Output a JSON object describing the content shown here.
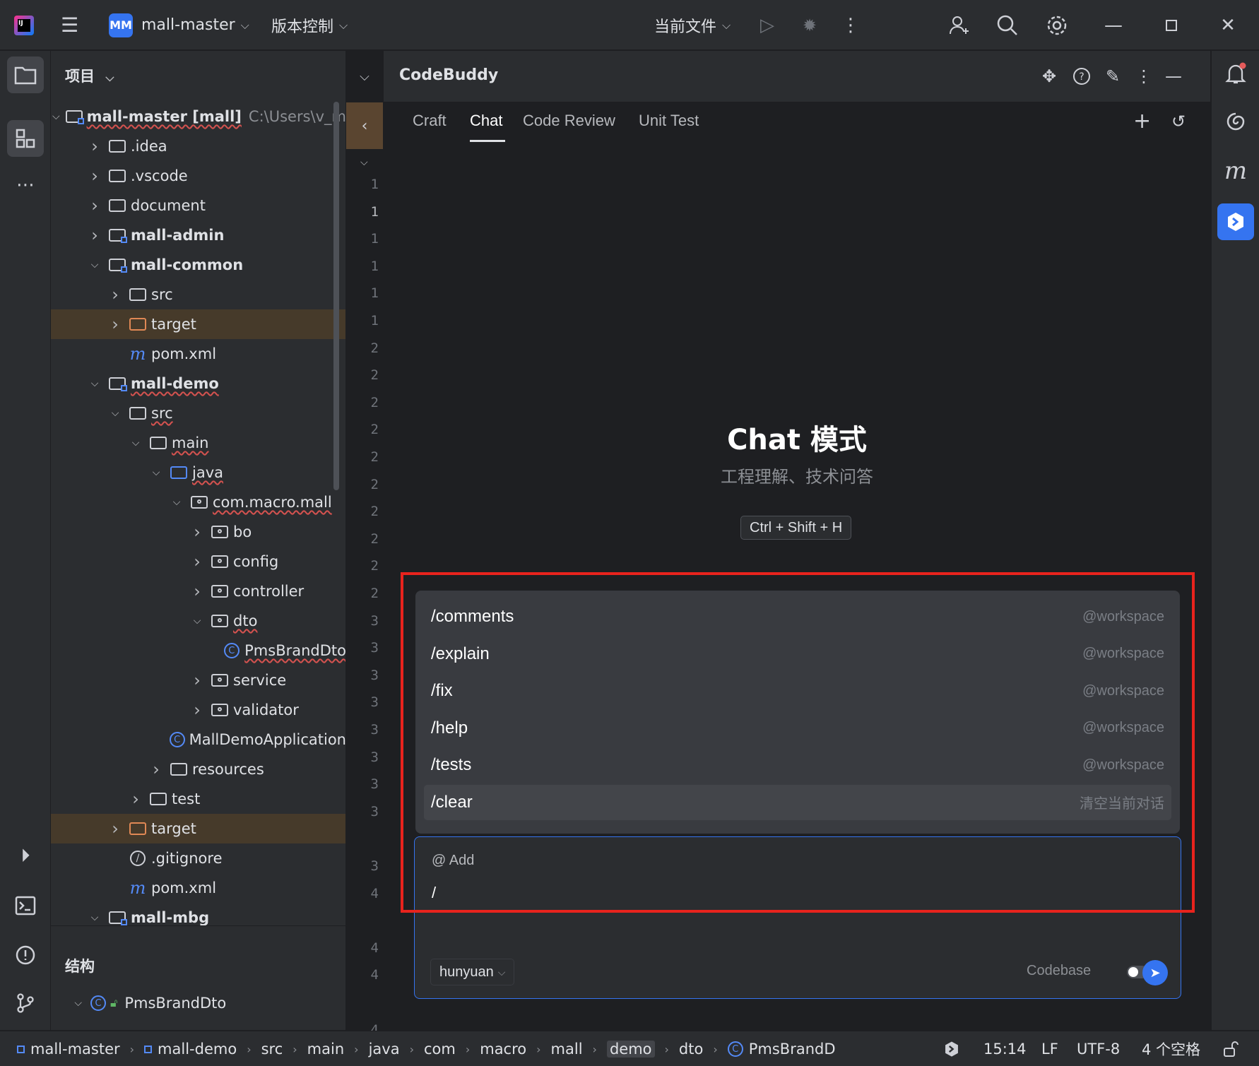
{
  "titlebar": {
    "project_badge": "MM",
    "project_name": "mall-master",
    "vcs_label": "版本控制",
    "run_config": "当前文件"
  },
  "project_panel": {
    "title": "项目",
    "tree": [
      {
        "label": "mall-master [mall]",
        "path": "C:\\Users\\v_m",
        "indent": 0,
        "arrow": "down",
        "icon": "module-folder",
        "bold": true,
        "squig": true
      },
      {
        "label": ".idea",
        "indent": 1,
        "arrow": "right",
        "icon": "folder"
      },
      {
        "label": ".vscode",
        "indent": 1,
        "arrow": "right",
        "icon": "folder"
      },
      {
        "label": "document",
        "indent": 1,
        "arrow": "right",
        "icon": "folder"
      },
      {
        "label": "mall-admin",
        "indent": 1,
        "arrow": "right",
        "icon": "module-folder",
        "bold": true
      },
      {
        "label": "mall-common",
        "indent": 1,
        "arrow": "down",
        "icon": "module-folder",
        "bold": true
      },
      {
        "label": "src",
        "indent": 2,
        "arrow": "right",
        "icon": "folder"
      },
      {
        "label": "target",
        "indent": 2,
        "arrow": "right",
        "icon": "folder-orange",
        "highlight": true
      },
      {
        "label": "pom.xml",
        "indent": 2,
        "arrow": "",
        "icon": "maven"
      },
      {
        "label": "mall-demo",
        "indent": 1,
        "arrow": "down",
        "icon": "module-folder",
        "bold": true,
        "squig": true
      },
      {
        "label": "src",
        "indent": 2,
        "arrow": "down",
        "icon": "folder",
        "squig": true
      },
      {
        "label": "main",
        "indent": 3,
        "arrow": "down",
        "icon": "folder",
        "squig": true
      },
      {
        "label": "java",
        "indent": 4,
        "arrow": "down",
        "icon": "folder-blue",
        "squig": true
      },
      {
        "label": "com.macro.mall",
        "indent": 5,
        "arrow": "down",
        "icon": "package",
        "squig": true
      },
      {
        "label": "bo",
        "indent": 6,
        "arrow": "right",
        "icon": "package"
      },
      {
        "label": "config",
        "indent": 6,
        "arrow": "right",
        "icon": "package"
      },
      {
        "label": "controller",
        "indent": 6,
        "arrow": "right",
        "icon": "package"
      },
      {
        "label": "dto",
        "indent": 6,
        "arrow": "down",
        "icon": "package",
        "squig": true
      },
      {
        "label": "PmsBrandDto",
        "indent": 7,
        "arrow": "",
        "icon": "class",
        "squig": true
      },
      {
        "label": "service",
        "indent": 6,
        "arrow": "right",
        "icon": "package"
      },
      {
        "label": "validator",
        "indent": 6,
        "arrow": "right",
        "icon": "package"
      },
      {
        "label": "MallDemoApplication",
        "indent": 6,
        "arrow": "",
        "icon": "class"
      },
      {
        "label": "resources",
        "indent": 4,
        "arrow": "right",
        "icon": "folder"
      },
      {
        "label": "test",
        "indent": 3,
        "arrow": "right",
        "icon": "folder"
      },
      {
        "label": "target",
        "indent": 2,
        "arrow": "right",
        "icon": "folder-orange",
        "highlight": true
      },
      {
        "label": ".gitignore",
        "indent": 2,
        "arrow": "",
        "icon": "ignore"
      },
      {
        "label": "pom.xml",
        "indent": 2,
        "arrow": "",
        "icon": "maven"
      },
      {
        "label": "mall-mbg",
        "indent": 1,
        "arrow": "down",
        "icon": "module-folder",
        "bold": true
      }
    ]
  },
  "structure_panel": {
    "title": "结构",
    "item": "PmsBrandDto"
  },
  "gutter": {
    "line_numbers": [
      "1",
      "1",
      "1",
      "1",
      "1",
      "1",
      "2",
      "2",
      "2",
      "2",
      "2",
      "2",
      "2",
      "2",
      "2",
      "2",
      "3",
      "3",
      "3",
      "3",
      "3",
      "3",
      "3",
      "3",
      "",
      "3",
      "4",
      "",
      "4",
      "4",
      "",
      "4"
    ]
  },
  "codebuddy": {
    "title": "CodeBuddy",
    "tabs": [
      "Craft",
      "Chat",
      "Code Review",
      "Unit Test"
    ],
    "active_tab": "Chat",
    "mode_title": "Chat 模式",
    "mode_subtitle": "工程理解、技术问答",
    "shortcut": "Ctrl + Shift + H",
    "commands": [
      {
        "name": "/comments",
        "hint": "@workspace"
      },
      {
        "name": "/explain",
        "hint": "@workspace"
      },
      {
        "name": "/fix",
        "hint": "@workspace"
      },
      {
        "name": "/help",
        "hint": "@workspace"
      },
      {
        "name": "/tests",
        "hint": "@workspace"
      },
      {
        "name": "/clear",
        "hint": "清空当前对话"
      }
    ],
    "selected_command": "/clear",
    "input": {
      "add_context": "@ Add",
      "value": "/",
      "model": "hunyuan",
      "codebase_label": "Codebase",
      "codebase_enabled": false
    }
  },
  "statusbar": {
    "breadcrumbs": [
      "mall-master",
      "mall-demo",
      "src",
      "main",
      "java",
      "com",
      "macro",
      "mall",
      "demo",
      "dto",
      "PmsBrandD"
    ],
    "time": "15:14",
    "line_sep": "LF",
    "encoding": "UTF-8",
    "indent": "4 个空格"
  },
  "colors": {
    "accent": "#3574f0",
    "highlight_box": "#e8231d",
    "panel_bg": "#2b2d30",
    "editor_bg": "#1e1f22"
  }
}
